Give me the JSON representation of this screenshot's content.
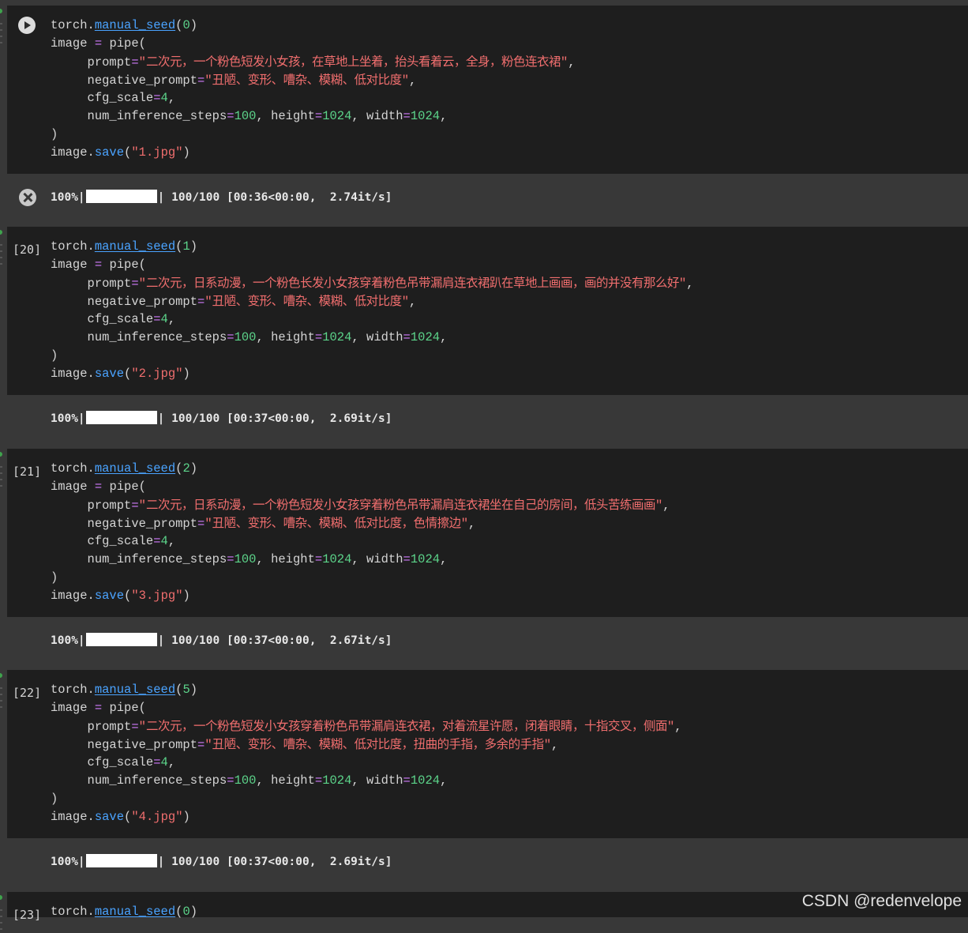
{
  "cells": [
    {
      "exec_count": "",
      "seed": "0",
      "prompt": "二次元，一个粉色短发小女孩，在草地上坐着，抬头看着云，全身，粉色连衣裙",
      "negative_prompt": "丑陋、变形、嘈杂、模糊、低对比度",
      "cfg": "4",
      "steps": "100",
      "height": "1024",
      "width": "1024",
      "file": "1.jpg",
      "output": {
        "percent": "100%",
        "progress": "100/100 [00:36<00:00,",
        "rate": "2.74it/s]",
        "progress_fraction": 1.0
      }
    },
    {
      "exec_count": "[20]",
      "seed": "1",
      "prompt": "二次元，日系动漫，一个粉色长发小女孩穿着粉色吊带漏肩连衣裙趴在草地上画画，画的并没有那么好",
      "negative_prompt": "丑陋、变形、嘈杂、模糊、低对比度",
      "cfg": "4",
      "steps": "100",
      "height": "1024",
      "width": "1024",
      "file": "2.jpg",
      "output": {
        "percent": "100%",
        "progress": "100/100 [00:37<00:00,",
        "rate": "2.69it/s]",
        "progress_fraction": 1.0
      }
    },
    {
      "exec_count": "[21]",
      "seed": "2",
      "prompt": "二次元，日系动漫，一个粉色短发小女孩穿着粉色吊带漏肩连衣裙坐在自己的房间，低头苦练画画",
      "negative_prompt": "丑陋、变形、嘈杂、模糊、低对比度，色情擦边",
      "cfg": "4",
      "steps": "100",
      "height": "1024",
      "width": "1024",
      "file": "3.jpg",
      "output": {
        "percent": "100%",
        "progress": "100/100 [00:37<00:00,",
        "rate": "2.67it/s]",
        "progress_fraction": 1.0
      }
    },
    {
      "exec_count": "[22]",
      "seed": "5",
      "prompt": "二次元，一个粉色短发小女孩穿着粉色吊带漏肩连衣裙，对着流星许愿，闭着眼睛，十指交叉，侧面",
      "negative_prompt": "丑陋、变形、嘈杂、模糊、低对比度，扭曲的手指，多余的手指",
      "cfg": "4",
      "steps": "100",
      "height": "1024",
      "width": "1024",
      "file": "4.jpg",
      "output": {
        "percent": "100%",
        "progress": "100/100 [00:37<00:00,",
        "rate": "2.69it/s]",
        "progress_fraction": 1.0
      }
    },
    {
      "exec_count": "[23]",
      "seed": "0"
    }
  ],
  "code_tokens": {
    "torch": "torch",
    "dot": ".",
    "manual_seed": "manual_seed",
    "lparen": "(",
    "rparen": ")",
    "image": "image",
    "eq": "=",
    "pipe": "pipe",
    "prompt_kw": "prompt",
    "neg_kw": "negative_prompt",
    "cfg_kw": "cfg_scale",
    "steps_kw": "num_inference_steps",
    "height_kw": "height",
    "width_kw": "width",
    "save": "save",
    "quote": "\"",
    "comma": ",",
    "sep": ", "
  },
  "watermark": "CSDN @redenvelope",
  "colors": {
    "function": "#4aa3ff",
    "number": "#5cd48a",
    "string": "#f06e6e",
    "operator": "#d27cff",
    "cell_bg": "#1e1e1e",
    "page_bg": "#383838"
  }
}
